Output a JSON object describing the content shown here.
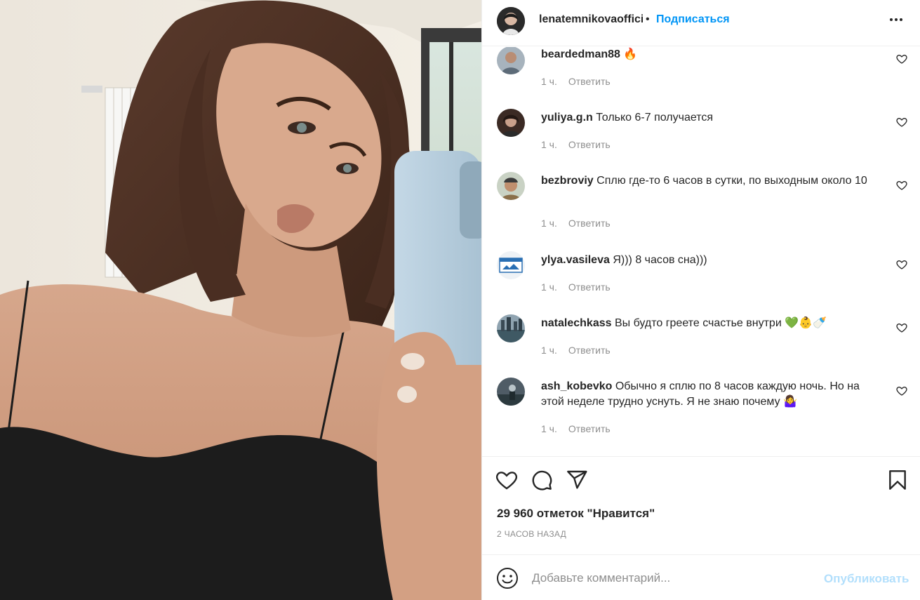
{
  "post": {
    "author": "lenatemnikovaofficial",
    "follow_label": "Подписаться",
    "dot": "•",
    "photo_icon": "photo-mirror-selfie",
    "more_icon": "more-options-icon"
  },
  "comments": [
    {
      "username": "beardedman88",
      "text": "🔥",
      "time": "1 ч.",
      "reply": "Ответить"
    },
    {
      "username": "yuliya.g.n",
      "text": "Только 6-7 получается",
      "time": "1 ч.",
      "reply": "Ответить"
    },
    {
      "username": "bezbroviy",
      "text": "Сплю где-то 6 часов в сутки, по выходным около 10",
      "time": "1 ч.",
      "reply": "Ответить"
    },
    {
      "username": "ylya.vasileva",
      "text": "Я))) 8 часов сна)))",
      "time": "1 ч.",
      "reply": "Ответить"
    },
    {
      "username": "natalechkass",
      "text": "Вы будто греете счастье внутри 💚👶🍼",
      "time": "1 ч.",
      "reply": "Ответить"
    },
    {
      "username": "ash_kobevko",
      "text": "Обычно я сплю по 8 часов каждую ночь. Но на этой неделе трудно уснуть. Я не знаю почему 🤷‍♀️",
      "time": "1 ч.",
      "reply": "Ответить"
    }
  ],
  "actions": {
    "like_icon": "heart-icon",
    "comment_icon": "comment-icon",
    "share_icon": "share-icon",
    "save_icon": "bookmark-icon"
  },
  "likes_text": "29 960 отметок \"Нравится\"",
  "posted_time": "2 ЧАСОВ НАЗАД",
  "composer": {
    "placeholder": "Добавьте комментарий...",
    "post_label": "Опубликовать"
  },
  "colors": {
    "accent": "#0095f6",
    "post_disabled": "#b2dffc",
    "secondary_text": "#8e8e8e"
  }
}
